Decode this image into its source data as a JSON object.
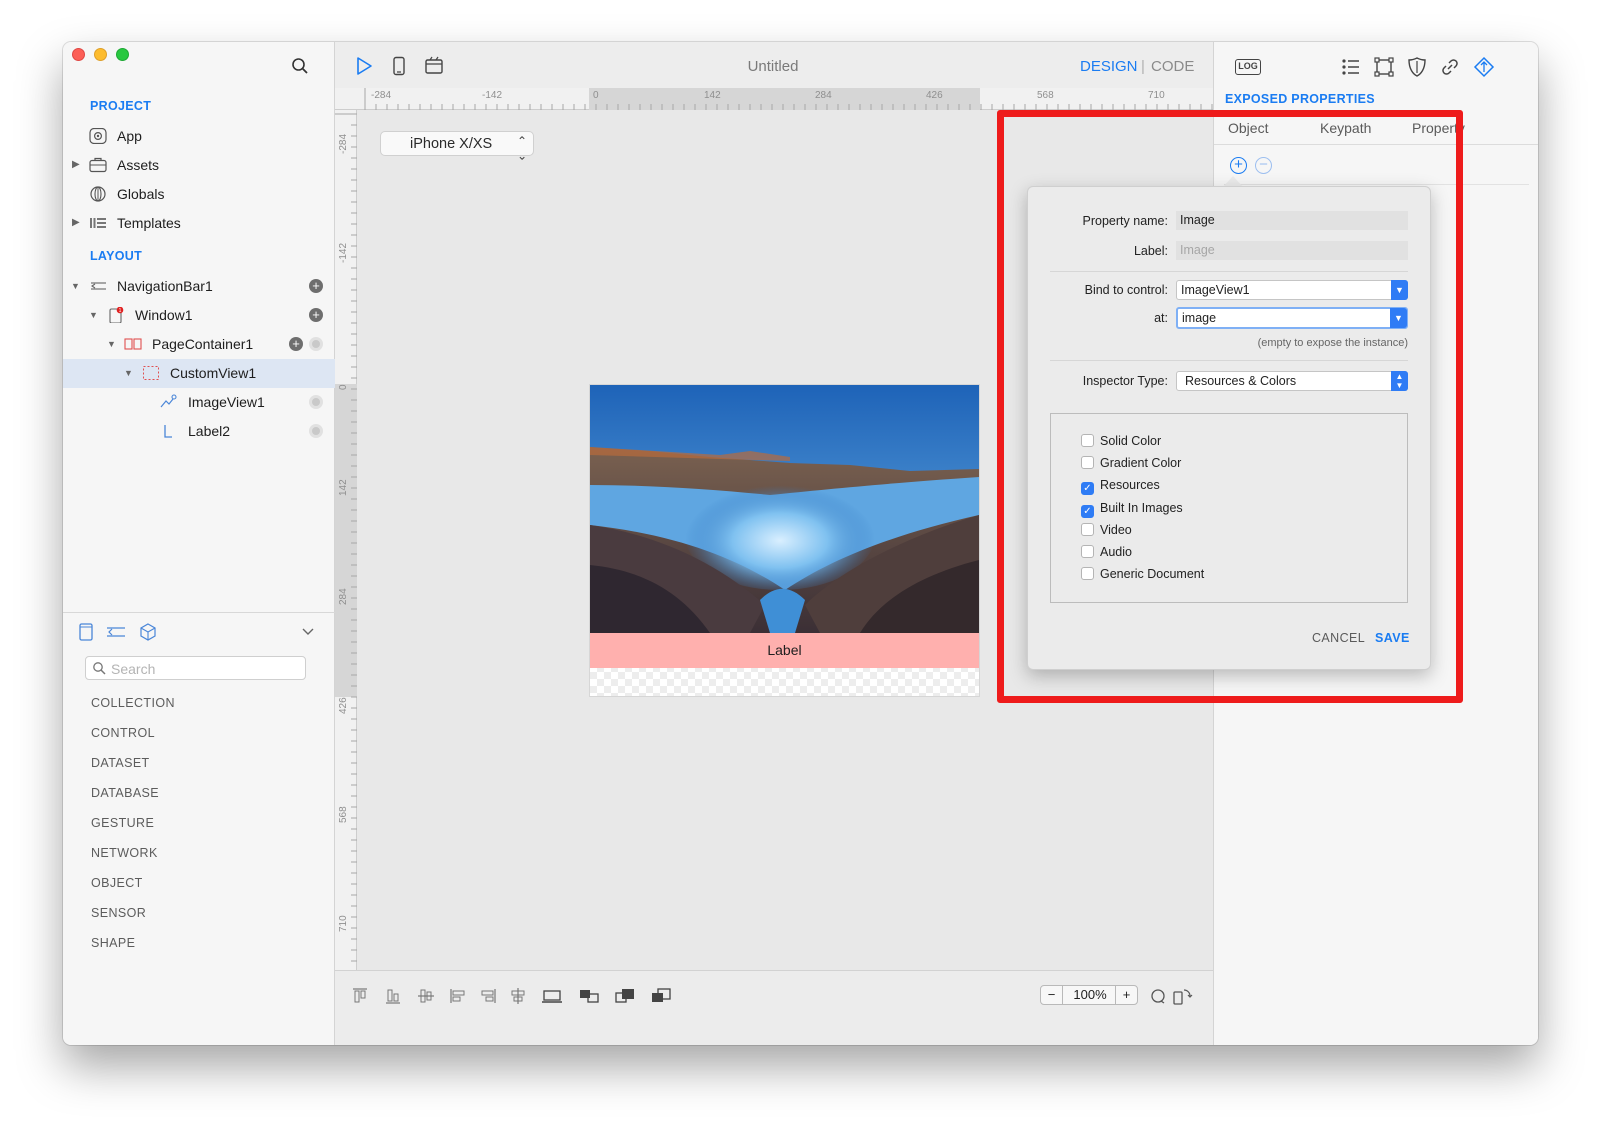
{
  "window": {
    "title": "Untitled",
    "modes": {
      "design": "DESIGN",
      "separator": "|",
      "code": "CODE"
    }
  },
  "sidebar": {
    "project_title": "PROJECT",
    "project_items": [
      {
        "label": "App",
        "icon": "app-icon"
      },
      {
        "label": "Assets",
        "icon": "briefcase-icon"
      },
      {
        "label": "Globals",
        "icon": "globe-icon"
      },
      {
        "label": "Templates",
        "icon": "templates-icon"
      }
    ],
    "layout_title": "LAYOUT",
    "layout_items": [
      {
        "label": "NavigationBar1",
        "icon": "navbar-icon"
      },
      {
        "label": "Window1",
        "icon": "window-icon",
        "badge": "1"
      },
      {
        "label": "PageContainer1",
        "icon": "page-container-icon"
      },
      {
        "label": "CustomView1",
        "icon": "custom-view-icon",
        "selected": true
      },
      {
        "label": "ImageView1",
        "icon": "image-view-icon"
      },
      {
        "label": "Label2",
        "icon": "label-icon"
      }
    ],
    "search_placeholder": "Search",
    "categories": [
      "COLLECTION",
      "CONTROL",
      "DATASET",
      "DATABASE",
      "GESTURE",
      "NETWORK",
      "OBJECT",
      "SENSOR",
      "SHAPE"
    ]
  },
  "canvas": {
    "device": "iPhone X/XS",
    "hruler_ticks": [
      "-284",
      "-142",
      "0",
      "142",
      "284",
      "426",
      "568",
      "710"
    ],
    "vruler_ticks": [
      "-284",
      "-142",
      "0",
      "142",
      "284",
      "426",
      "568",
      "710"
    ],
    "label_text": "Label",
    "zoom": "100%",
    "zoom_minus": "−",
    "zoom_plus": "+"
  },
  "inspector": {
    "log_label": "LOG",
    "title": "EXPOSED PROPERTIES",
    "columns": [
      "Object",
      "Keypath",
      "Property"
    ],
    "add_symbol": "+",
    "remove_symbol": "−"
  },
  "dialog": {
    "property_name_label": "Property name:",
    "property_name_value": "Image",
    "label_label": "Label:",
    "label_placeholder": "Image",
    "bind_label": "Bind to control:",
    "bind_value": "ImageView1",
    "at_label": "at:",
    "at_value": "image",
    "hint": "(empty to expose the instance)",
    "inspector_type_label": "Inspector Type:",
    "inspector_type_value": "Resources & Colors",
    "options": [
      {
        "label": "Solid Color",
        "checked": false
      },
      {
        "label": "Gradient Color",
        "checked": false
      },
      {
        "label": "Resources",
        "checked": true
      },
      {
        "label": "Built In Images",
        "checked": true
      },
      {
        "label": "Video",
        "checked": false
      },
      {
        "label": "Audio",
        "checked": false
      },
      {
        "label": "Generic Document",
        "checked": false
      }
    ],
    "cancel": "CANCEL",
    "save": "SAVE"
  },
  "colors": {
    "accent": "#1a7cf2",
    "highlight": "#ee1b1b",
    "label_bg": "#ffb0ae"
  }
}
